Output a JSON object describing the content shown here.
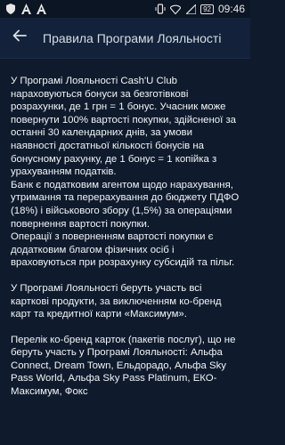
{
  "status": {
    "time": "09:46",
    "battery": "92"
  },
  "appbar": {
    "title": "Правила Програми Лояльності"
  },
  "content": {
    "p1": "У Програмі Лояльності Cash'U Club нараховуються бонуси за безготівкові розрахунки, де 1 грн = 1 бонус. Учасник може повернути 100% вартості покупки, здійсненої за останні 30 календарних днів, за умови наявності достатньої кількості бонусів на бонусному рахунку, де 1 бонус = 1 копійка з урахуванням податків.",
    "p2": "Банк є податковим агентом щодо нарахування, утримання та перерахування до бюджету ПДФО (18%) і військового збору (1,5%) за операціями повернення вартості покупки.",
    "p3": "Операції з поверненням вартості покупки є додатковим благом фізичних осіб і враховуються при розрахунку субсидій та пільг.",
    "p4": "У Програмі Лояльності беруть участь всі карткові продукти, за виключенням ко-бренд карт та кредитної карти «Максимум».",
    "p5": "Перелік ко-бренд карток (пакетів послуг), що не беруть участь у Програмі Лояльності: Альфа Connect, Dream Town, Ельдорадо, Альфа Sky Pass World, Альфа Sky Pass Platinum, ЕКО-Максимум, Фокс"
  },
  "icons": {
    "back": "arrow-left-icon"
  }
}
